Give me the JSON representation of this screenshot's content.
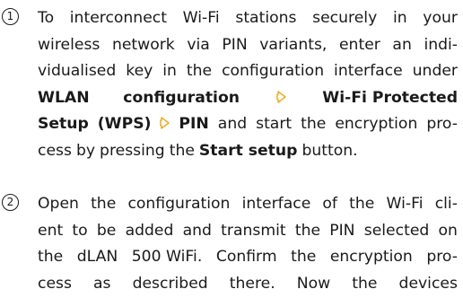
{
  "steps": [
    {
      "number": "①",
      "lines": [
        [
          "To",
          "interconnect",
          "Wi-Fi",
          "stations",
          "securely",
          "in",
          "your"
        ],
        [
          "wireless",
          "network",
          "via",
          "PIN",
          "variants,",
          "enter",
          "an",
          "indi-"
        ],
        [
          "vidualised",
          "key",
          "in",
          "the",
          "configuration",
          "interface",
          "under"
        ],
        [
          "WLAN",
          "configuration"
        ],
        [
          "Setup",
          "(WPS)"
        ],
        [
          "cess",
          "by",
          "pressing",
          "the"
        ]
      ],
      "wps_label": "Wi-Fi Protected",
      "pin_label": "PIN",
      "rest_line5": [
        "and",
        "start",
        "the",
        "encryption",
        "pro-"
      ],
      "start_setup": "Start setup",
      "button_word": "button."
    },
    {
      "number": "②",
      "lines": [
        [
          "Open",
          "the",
          "configuration",
          "interface",
          "of",
          "the",
          "Wi-Fi",
          "cli-"
        ],
        [
          "ent",
          "to",
          "be",
          "added",
          "and",
          "transmit",
          "the",
          "PIN",
          "selected",
          "on"
        ],
        [
          "the",
          "dLAN",
          "500 WiFi.",
          "Confirm",
          "the",
          "encryption",
          "pro-"
        ],
        [
          "cess",
          "as",
          "described",
          "there.",
          "Now",
          "the",
          "devices"
        ]
      ]
    }
  ],
  "icons": {
    "menu_arrow": "arrow-outline-right-icon"
  }
}
